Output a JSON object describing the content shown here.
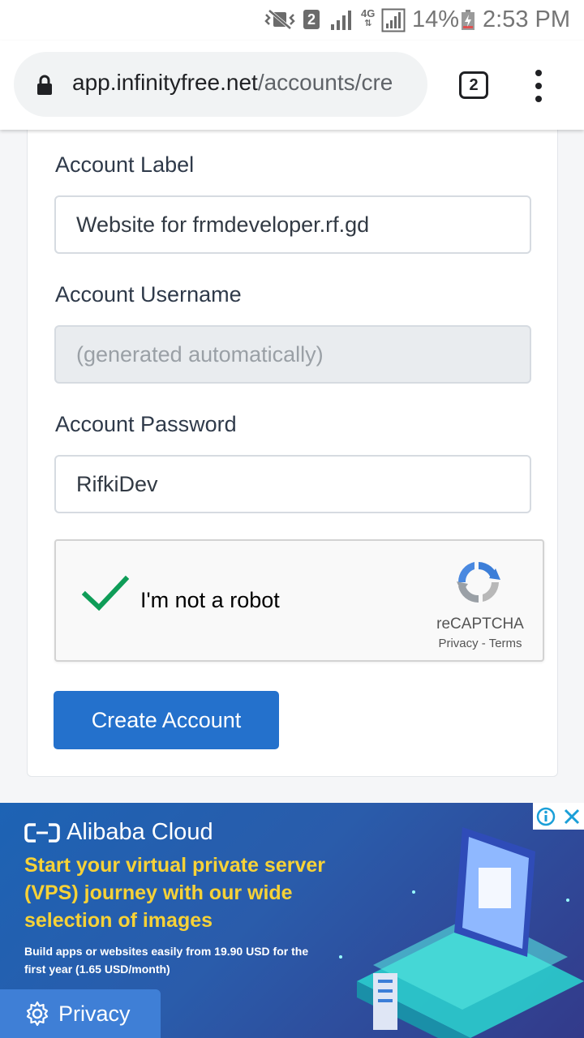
{
  "status_bar": {
    "sim_slot": "2",
    "network": "4G",
    "battery": "14%",
    "time": "2:53 PM"
  },
  "browser": {
    "url_host": "app.infinityfree.net",
    "url_path": "/accounts/cre",
    "tab_count": "2"
  },
  "form": {
    "label_field": {
      "label": "Account Label",
      "value": "Website for frmdeveloper.rf.gd"
    },
    "username_field": {
      "label": "Account Username",
      "placeholder": "(generated automatically)"
    },
    "password_field": {
      "label": "Account Password",
      "value": "RifkiDev"
    },
    "recaptcha": {
      "label": "I'm not a robot",
      "brand": "reCAPTCHA",
      "privacy_link": "Privacy",
      "separator": "-",
      "terms_link": "Terms",
      "checked": true
    },
    "submit_label": "Create Account"
  },
  "ad": {
    "brand": "Alibaba Cloud",
    "headline": "Start your virtual private server (VPS) journey with our wide selection of images",
    "subline": "Build apps or websites easily from 19.90 USD for the first year (1.65 USD/month)"
  },
  "privacy_button": {
    "label": "Privacy"
  },
  "colors": {
    "primary_button": "#2471cc",
    "check_green": "#0f9d58",
    "ad_headline": "#f7d237"
  }
}
